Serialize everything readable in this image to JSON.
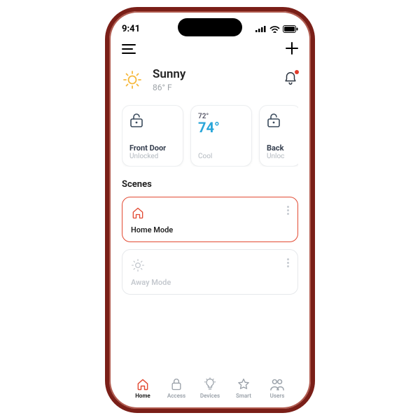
{
  "statusbar": {
    "time": "9:41"
  },
  "weather": {
    "condition": "Sunny",
    "temperature": "86° F"
  },
  "cards": [
    {
      "label": "Front Door",
      "status": "Unlocked"
    },
    {
      "topline": "72°",
      "big": "74°",
      "status": "Cool"
    },
    {
      "label": "Back",
      "status": "Unloc"
    }
  ],
  "scenes": {
    "title": "Scenes",
    "items": [
      {
        "label": "Home Mode"
      },
      {
        "label": "Away Mode"
      }
    ]
  },
  "tabs": [
    {
      "label": "Home"
    },
    {
      "label": "Access"
    },
    {
      "label": "Devices"
    },
    {
      "label": "Smart"
    },
    {
      "label": "Users"
    }
  ]
}
